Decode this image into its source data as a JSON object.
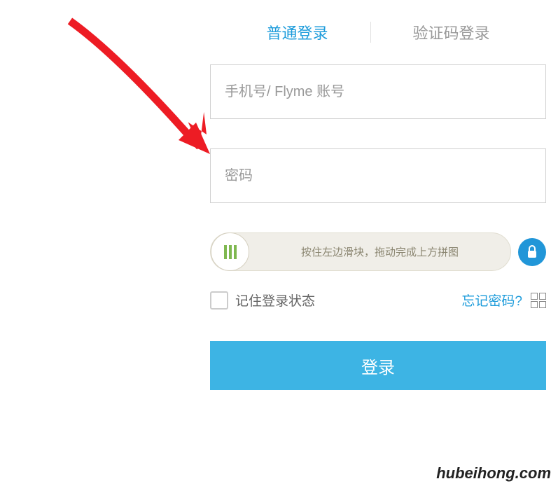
{
  "tabs": {
    "password_login": "普通登录",
    "code_login": "验证码登录"
  },
  "inputs": {
    "username_placeholder": "手机号/ Flyme 账号",
    "password_placeholder": "密码"
  },
  "slider": {
    "text": "按住左边滑块，拖动完成上方拼图"
  },
  "options": {
    "remember_label": "记住登录状态",
    "forgot_label": "忘记密码?"
  },
  "login_button": "登录",
  "watermark": "hubeihong.com"
}
